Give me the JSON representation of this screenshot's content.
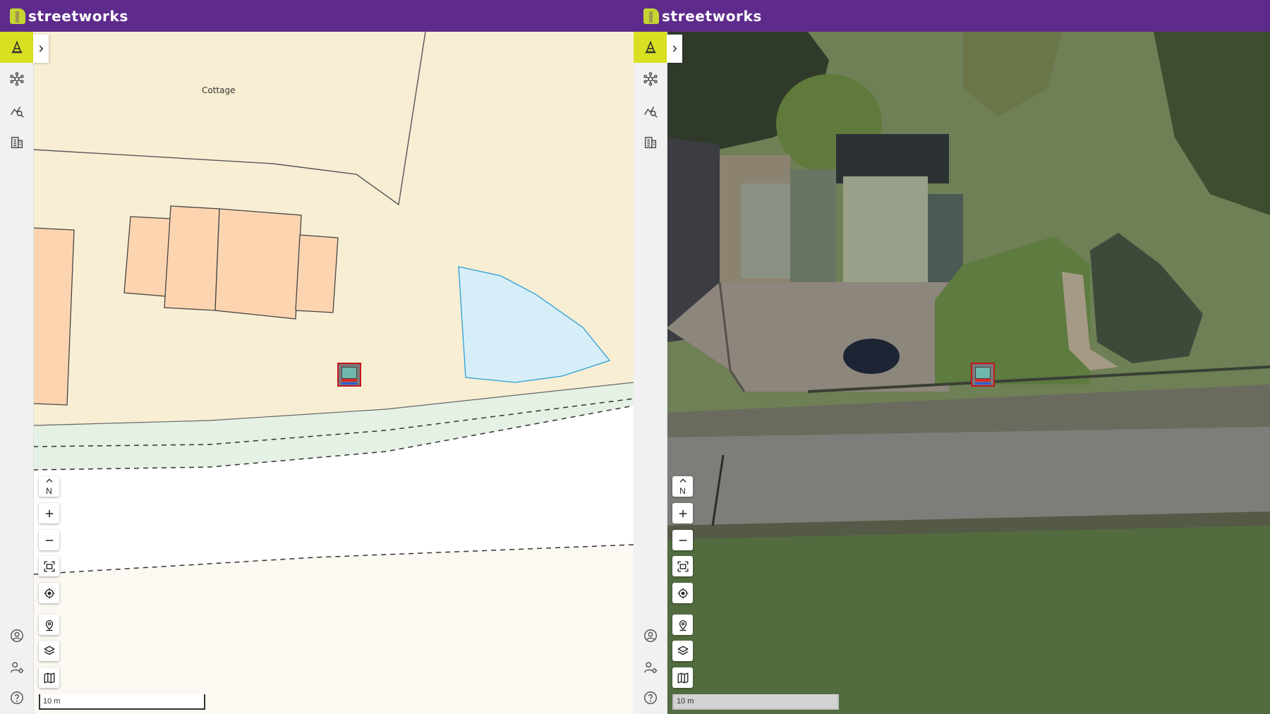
{
  "app": {
    "brand": "streetworks"
  },
  "colors": {
    "header": "#5e2b8c",
    "logo_accent": "#c7d530",
    "active_tool": "#d9e021",
    "building": "#fcd5b0",
    "land": "#f7eed4",
    "water": "#d6eef8",
    "verge": "#e4f1e4",
    "marker_border": "#c4161c"
  },
  "sidebar": {
    "top_items": [
      {
        "name": "works-cone",
        "icon": "traffic-cone-icon",
        "active": true
      },
      {
        "name": "network",
        "icon": "network-icon",
        "active": false
      },
      {
        "name": "analytics-search",
        "icon": "chart-search-icon",
        "active": false
      },
      {
        "name": "buildings",
        "icon": "building-icon",
        "active": false
      }
    ],
    "bottom_items": [
      {
        "name": "account",
        "icon": "user-circle-icon"
      },
      {
        "name": "user-settings",
        "icon": "user-gear-icon"
      },
      {
        "name": "help",
        "icon": "help-circle-icon"
      }
    ],
    "expand_icon": "chevron-right-icon"
  },
  "panels": {
    "left": {
      "mode": "street-map",
      "place_label": "Cottage",
      "scale_label": "10 m"
    },
    "right": {
      "mode": "satellite",
      "scale_label": "10 m"
    }
  },
  "map_controls": {
    "north": "N",
    "items": [
      {
        "name": "compass-north",
        "icon": "north-arrow-icon"
      },
      {
        "name": "zoom-in",
        "icon": "plus-icon"
      },
      {
        "name": "zoom-out",
        "icon": "minus-icon"
      },
      {
        "name": "zoom-to-extent",
        "icon": "fit-extent-icon"
      },
      {
        "name": "my-location",
        "icon": "crosshair-icon"
      },
      {
        "name": "map-pin",
        "icon": "map-pin-icon"
      },
      {
        "name": "layers",
        "icon": "layers-icon"
      },
      {
        "name": "basemap",
        "icon": "map-fold-icon"
      }
    ]
  },
  "marker": {
    "icon": "works-sign-icon"
  }
}
